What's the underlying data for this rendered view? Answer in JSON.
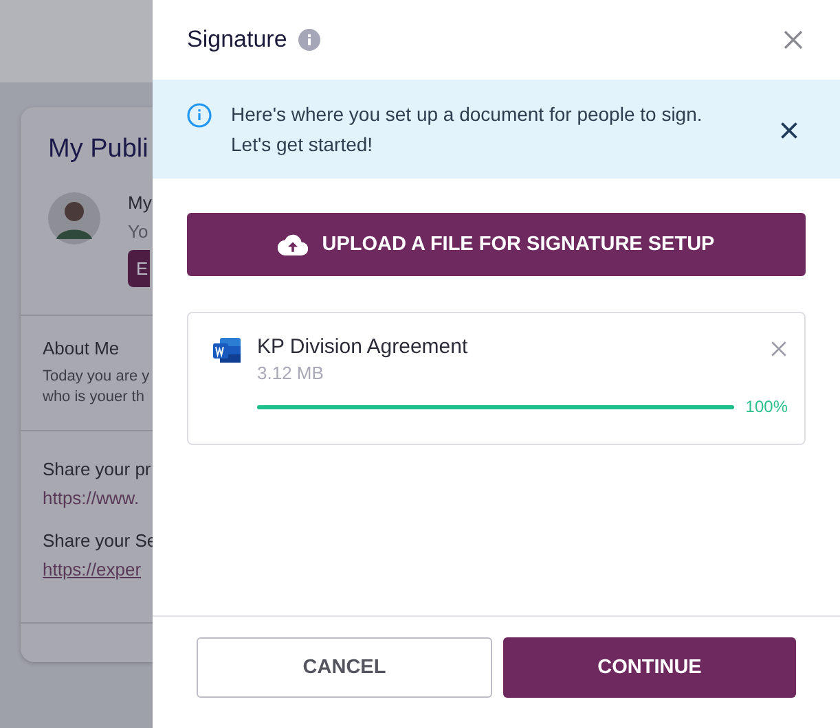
{
  "background_page": {
    "card_title": "My Publi",
    "profile_name": "My",
    "profile_subtitle": "Yo",
    "profile_button": "E",
    "about_heading": "About Me",
    "about_lines": [
      "Today you are y",
      "who is youer th"
    ],
    "share_links": [
      {
        "label": "Share your pr",
        "url": "https://www.",
        "underlined": false
      },
      {
        "label": "Share your Se",
        "url": "https://exper",
        "underlined": true
      }
    ]
  },
  "drawer": {
    "title": "Signature",
    "banner": {
      "lines": [
        "Here's where you set up a document for people to sign.",
        "Let's get started!"
      ]
    },
    "upload_button": "UPLOAD A FILE FOR SIGNATURE SETUP",
    "files": [
      {
        "name": "KP Division Agreement",
        "size": "3.12 MB",
        "level": 1,
        "percent": "100%"
      }
    ],
    "buttons": [
      {
        "label": "CANCEL",
        "kind": "secondary"
      },
      {
        "label": "CONTINUE",
        "kind": "primary"
      }
    ]
  }
}
